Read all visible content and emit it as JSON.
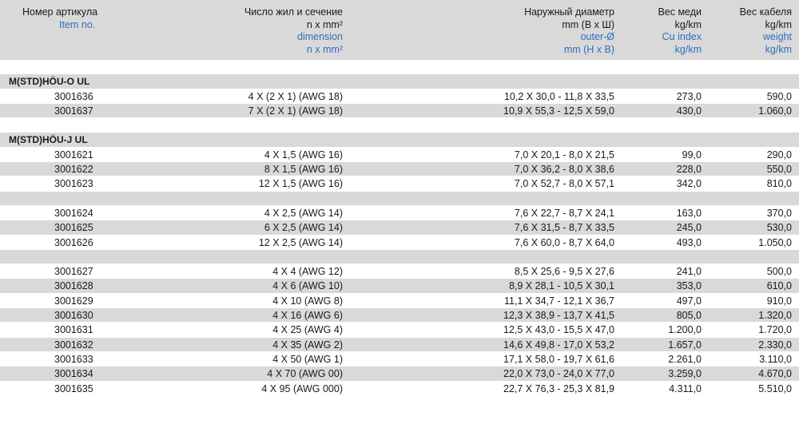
{
  "header": {
    "article_ru": "Номер артикула",
    "article_en": "Item no.",
    "dim_ru_1": "Число жил и сечение",
    "dim_ru_2": "n x mm²",
    "dim_en_1": "dimension",
    "dim_en_2": "n x mm²",
    "od_ru_1": "Наружный диаметр",
    "od_ru_2": "mm (В х Ш)",
    "od_en_1": "outer-Ø",
    "od_en_2": "mm (H x B)",
    "cu_ru_1": "Вес меди",
    "cu_ru_2": "kg/km",
    "cu_en_1": "Cu index",
    "cu_en_2": "kg/km",
    "wt_ru_1": "Вес кабеля",
    "wt_ru_2": "kg/km",
    "wt_en_1": "weight",
    "wt_en_2": "kg/km"
  },
  "rows": [
    {
      "kind": "spacer",
      "shade": "white"
    },
    {
      "kind": "group",
      "title": "M(STD)HÖU-O UL",
      "shade": "gray"
    },
    {
      "kind": "data",
      "shade": "white",
      "item": "3001636",
      "dim": "4 X (2 X 1) (AWG 18)",
      "od": "10,2 X 30,0 - 11,8 X 33,5",
      "cu": "273,0",
      "wt": "590,0"
    },
    {
      "kind": "data",
      "shade": "gray",
      "item": "3001637",
      "dim": "7 X (2 X 1) (AWG 18)",
      "od": "10,9 X 55,3 - 12,5 X 59,0",
      "cu": "430,0",
      "wt": "1.060,0"
    },
    {
      "kind": "spacer",
      "shade": "white"
    },
    {
      "kind": "group",
      "title": "M(STD)HÖU-J UL",
      "shade": "gray"
    },
    {
      "kind": "data",
      "shade": "white",
      "item": "3001621",
      "dim": "4 X 1,5 (AWG 16)",
      "od": "7,0 X 20,1 - 8,0 X 21,5",
      "cu": "99,0",
      "wt": "290,0"
    },
    {
      "kind": "data",
      "shade": "gray",
      "item": "3001622",
      "dim": "8 X 1,5 (AWG 16)",
      "od": "7,0 X 36,2 - 8,0 X 38,6",
      "cu": "228,0",
      "wt": "550,0"
    },
    {
      "kind": "data",
      "shade": "white",
      "item": "3001623",
      "dim": "12 X 1,5 (AWG 16)",
      "od": "7,0 X 52,7 - 8,0 X 57,1",
      "cu": "342,0",
      "wt": "810,0"
    },
    {
      "kind": "spacer",
      "shade": "gray"
    },
    {
      "kind": "data",
      "shade": "white",
      "item": "3001624",
      "dim": "4 X 2,5 (AWG 14)",
      "od": "7,6 X 22,7 - 8,7 X 24,1",
      "cu": "163,0",
      "wt": "370,0"
    },
    {
      "kind": "data",
      "shade": "gray",
      "item": "3001625",
      "dim": "6 X 2,5 (AWG 14)",
      "od": "7,6 X 31,5 - 8,7 X 33,5",
      "cu": "245,0",
      "wt": "530,0"
    },
    {
      "kind": "data",
      "shade": "white",
      "item": "3001626",
      "dim": "12 X 2,5 (AWG 14)",
      "od": "7,6 X 60,0 - 8,7 X 64,0",
      "cu": "493,0",
      "wt": "1.050,0"
    },
    {
      "kind": "spacer",
      "shade": "gray"
    },
    {
      "kind": "data",
      "shade": "white",
      "item": "3001627",
      "dim": "4 X 4 (AWG 12)",
      "od": "8,5 X 25,6 - 9,5 X 27,6",
      "cu": "241,0",
      "wt": "500,0"
    },
    {
      "kind": "data",
      "shade": "gray",
      "item": "3001628",
      "dim": "4 X 6 (AWG 10)",
      "od": "8,9 X 28,1 - 10,5 X 30,1",
      "cu": "353,0",
      "wt": "610,0"
    },
    {
      "kind": "data",
      "shade": "white",
      "item": "3001629",
      "dim": "4 X 10 (AWG 8)",
      "od": "11,1 X 34,7 - 12,1 X 36,7",
      "cu": "497,0",
      "wt": "910,0"
    },
    {
      "kind": "data",
      "shade": "gray",
      "item": "3001630",
      "dim": "4 X 16 (AWG 6)",
      "od": "12,3 X 38,9 - 13,7 X 41,5",
      "cu": "805,0",
      "wt": "1.320,0"
    },
    {
      "kind": "data",
      "shade": "white",
      "item": "3001631",
      "dim": "4 X 25 (AWG 4)",
      "od": "12,5 X 43,0 - 15,5 X 47,0",
      "cu": "1.200,0",
      "wt": "1.720,0"
    },
    {
      "kind": "data",
      "shade": "gray",
      "item": "3001632",
      "dim": "4 X 35 (AWG 2)",
      "od": "14,6 X 49,8 - 17,0 X 53,2",
      "cu": "1.657,0",
      "wt": "2.330,0"
    },
    {
      "kind": "data",
      "shade": "white",
      "item": "3001633",
      "dim": "4 X 50 (AWG 1)",
      "od": "17,1 X 58,0 - 19,7 X 61,6",
      "cu": "2.261,0",
      "wt": "3.110,0"
    },
    {
      "kind": "data",
      "shade": "gray",
      "item": "3001634",
      "dim": "4 X 70 (AWG 00)",
      "od": "22,0 X 73,0 - 24,0 X 77,0",
      "cu": "3.259,0",
      "wt": "4.670,0"
    },
    {
      "kind": "data",
      "shade": "white",
      "item": "3001635",
      "dim": "4 X 95 (AWG 000)",
      "od": "22,7 X 76,3 - 25,3 X 81,9",
      "cu": "4.311,0",
      "wt": "5.510,0"
    }
  ]
}
